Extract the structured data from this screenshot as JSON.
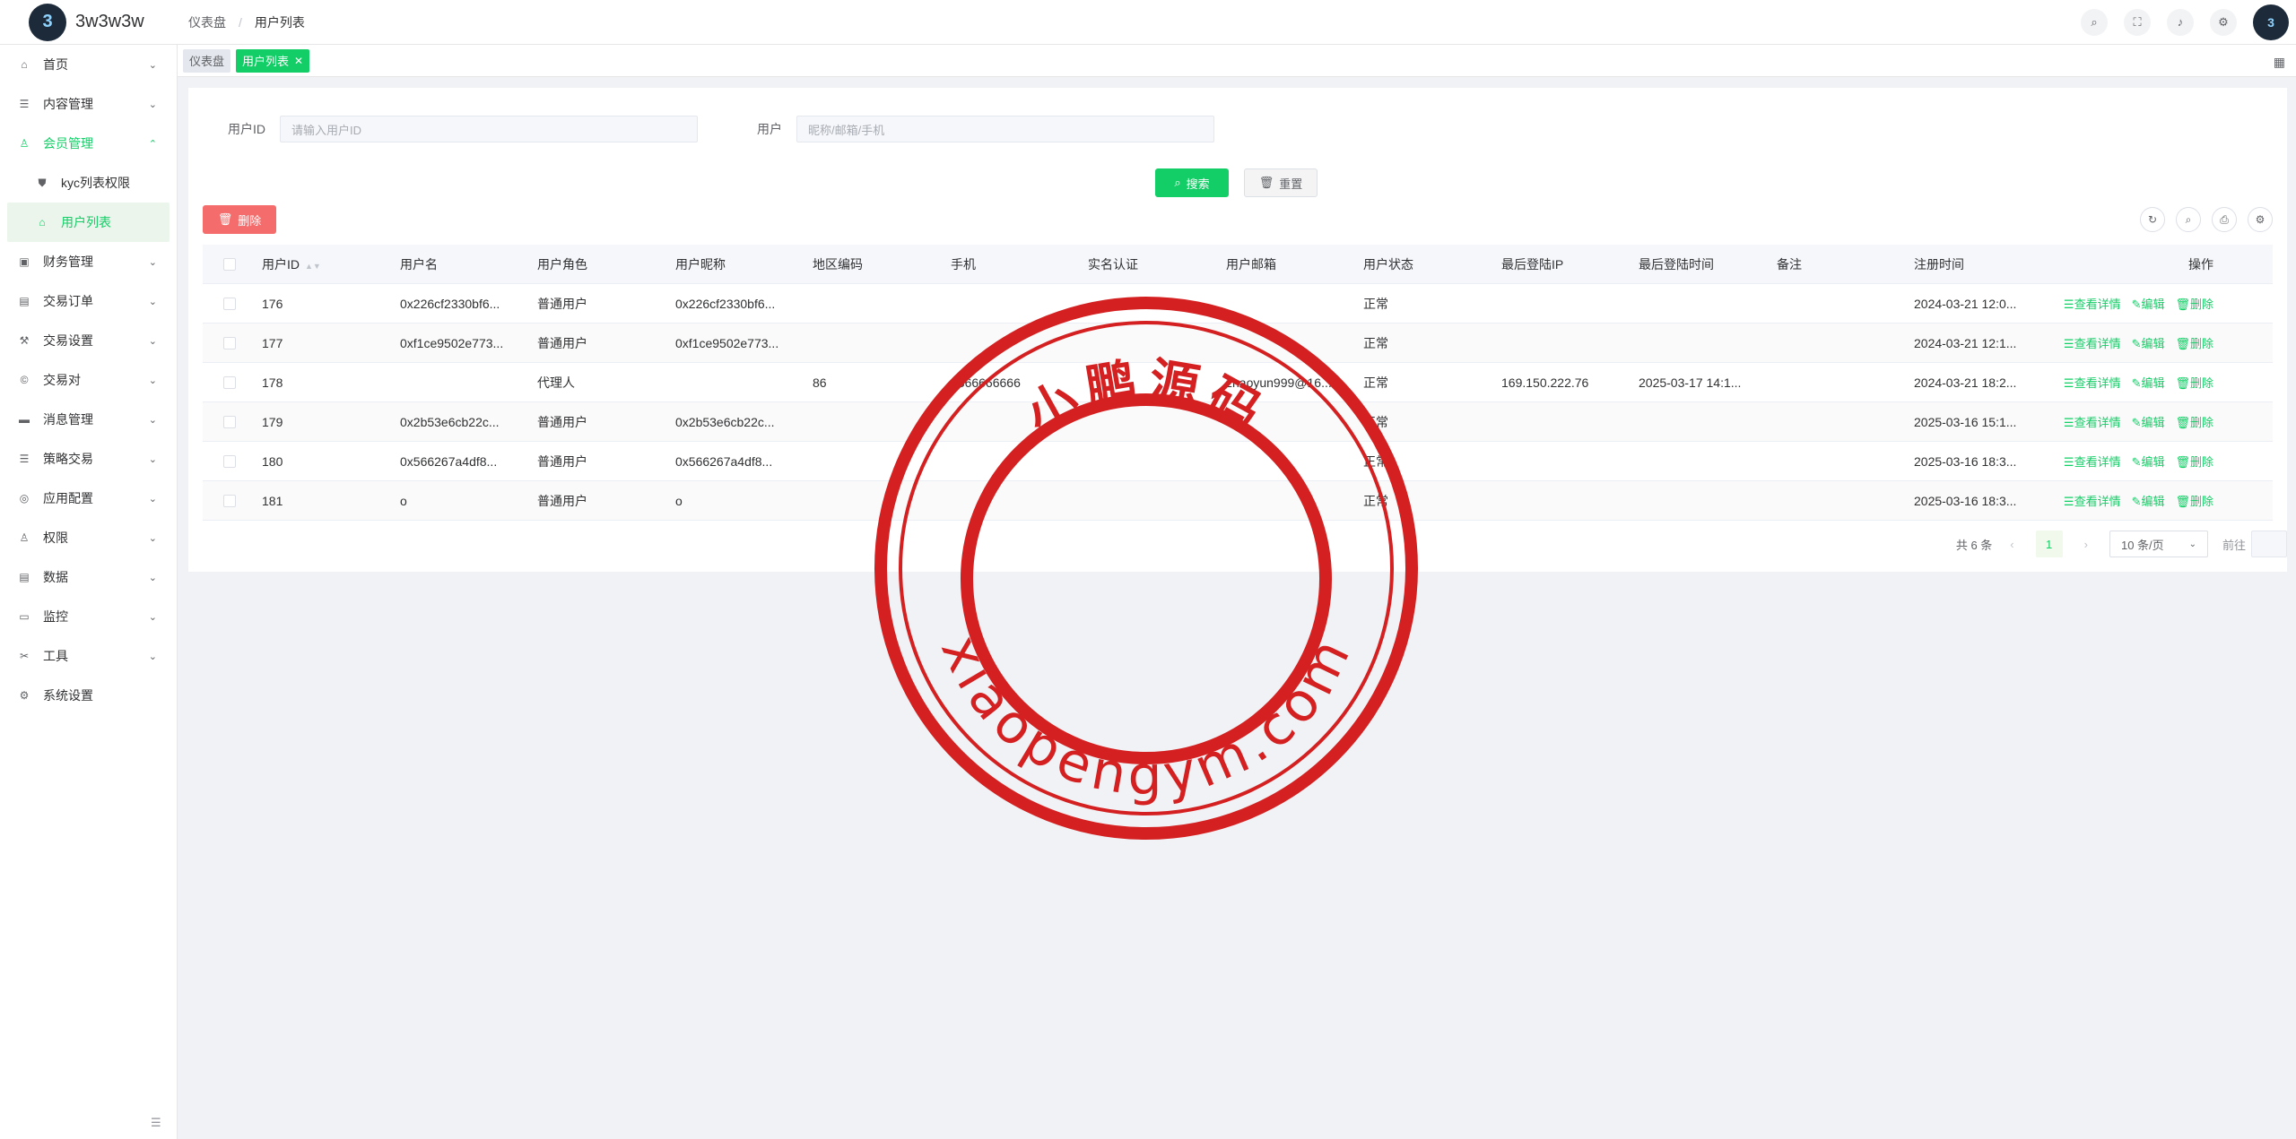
{
  "app": {
    "title": "3w3w3w",
    "logo_glyph": "3"
  },
  "breadcrumb": [
    "仪表盘",
    "用户列表"
  ],
  "header_icons": [
    "search-icon",
    "fullscreen-icon",
    "bell-icon",
    "settings-icon"
  ],
  "sidebar": {
    "items": [
      {
        "label": "首页",
        "icon": "⌂",
        "name": "home"
      },
      {
        "label": "内容管理",
        "icon": "☰",
        "name": "content"
      },
      {
        "label": "会员管理",
        "icon": "♙",
        "name": "member",
        "expanded": true
      },
      {
        "label": "财务管理",
        "icon": "▣",
        "name": "finance"
      },
      {
        "label": "交易订单",
        "icon": "▤",
        "name": "trade-orders"
      },
      {
        "label": "交易设置",
        "icon": "⚒",
        "name": "trade-settings"
      },
      {
        "label": "交易对",
        "icon": "©",
        "name": "trade-pairs"
      },
      {
        "label": "消息管理",
        "icon": "▬",
        "name": "messages"
      },
      {
        "label": "策略交易",
        "icon": "☰",
        "name": "strategy"
      },
      {
        "label": "应用配置",
        "icon": "◎",
        "name": "app-config"
      },
      {
        "label": "权限",
        "icon": "♙",
        "name": "permissions"
      },
      {
        "label": "数据",
        "icon": "▤",
        "name": "data"
      },
      {
        "label": "监控",
        "icon": "▭",
        "name": "monitor"
      },
      {
        "label": "工具",
        "icon": "✂",
        "name": "tools"
      },
      {
        "label": "系统设置",
        "icon": "⚙",
        "name": "system"
      }
    ],
    "submenu": [
      {
        "label": "kyc列表权限",
        "icon": "⛊"
      },
      {
        "label": "用户列表",
        "icon": "⌂",
        "active": true
      }
    ]
  },
  "tags": [
    {
      "label": "仪表盘",
      "active": false
    },
    {
      "label": "用户列表",
      "active": true
    }
  ],
  "filters": {
    "user_id_label": "用户ID",
    "user_id_placeholder": "请输入用户ID",
    "user_label": "用户",
    "user_placeholder": "昵称/邮箱/手机"
  },
  "buttons": {
    "search": "搜索",
    "reset": "重置",
    "delete": "删除"
  },
  "table": {
    "headers": [
      "用户ID",
      "用户名",
      "用户角色",
      "用户昵称",
      "地区编码",
      "手机",
      "实名认证",
      "用户邮箱",
      "用户状态",
      "最后登陆IP",
      "最后登陆时间",
      "备注",
      "注册时间",
      "操作"
    ],
    "rows": [
      [
        "176",
        "0x226cf2330bf6...",
        "普通用户",
        "0x226cf2330bf6...",
        "",
        "",
        "",
        "",
        "正常",
        "",
        "",
        "",
        "2024-03-21 12:0..."
      ],
      [
        "177",
        "0xf1ce9502e773...",
        "普通用户",
        "0xf1ce9502e773...",
        "",
        "",
        "",
        "",
        "正常",
        "",
        "",
        "",
        "2024-03-21 12:1..."
      ],
      [
        "178",
        "",
        "代理人",
        "",
        "86",
        "1366666666",
        "",
        "zhaoyun999@16...",
        "正常",
        "169.150.222.76",
        "2025-03-17 14:1...",
        "",
        "2024-03-21 18:2..."
      ],
      [
        "179",
        "0x2b53e6cb22c...",
        "普通用户",
        "0x2b53e6cb22c...",
        "",
        "",
        "",
        "",
        "正常",
        "",
        "",
        "",
        "2025-03-16 15:1..."
      ],
      [
        "180",
        "0x566267a4df8...",
        "普通用户",
        "0x566267a4df8...",
        "",
        "",
        "",
        "",
        "正常",
        "",
        "",
        "",
        "2025-03-16 18:3..."
      ],
      [
        "181",
        "o",
        "普通用户",
        "o",
        "",
        "",
        "",
        "",
        "正常",
        "",
        "",
        "",
        "2025-03-16 18:3..."
      ]
    ],
    "ops": [
      "☰查看详情",
      "✎编辑",
      "🗑删除"
    ]
  },
  "pagination": {
    "total": "共 6 条",
    "current": "1",
    "page_size": "10 条/页",
    "goto": "前往"
  },
  "watermark": {
    "top_text": "小鹏源码",
    "bottom_text": "xiaopengym.com",
    "color": "#d42020"
  },
  "colors": {
    "accent": "#13ce66",
    "danger": "#f56c6c"
  }
}
